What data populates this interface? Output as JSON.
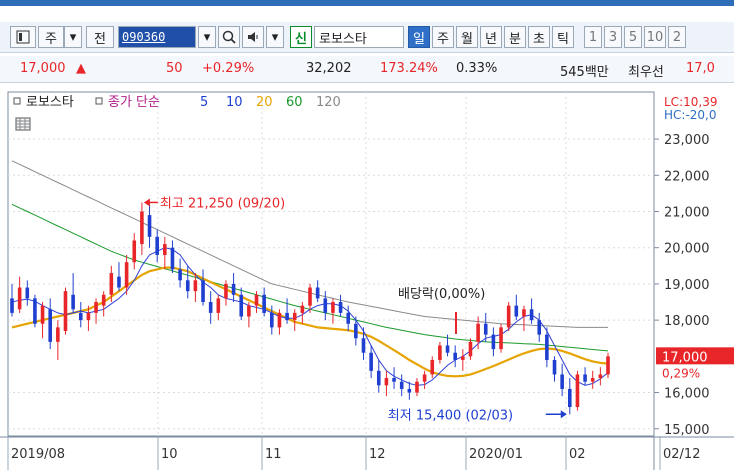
{
  "toolbar": {
    "icon": "window-icon",
    "type_label": "주",
    "prev_label": "전",
    "code": "090360",
    "search_icon": "search-icon",
    "speaker_icon": "speaker-icon",
    "credit_tag": "신",
    "stock_name": "로보스타",
    "periods": [
      "일",
      "주",
      "월",
      "년",
      "분",
      "초",
      "틱"
    ],
    "selected_period": "일",
    "numbers": [
      "1",
      "3",
      "5",
      "10",
      "2"
    ]
  },
  "quote": {
    "price": "17,000",
    "arrow": "▲",
    "change": "50",
    "change_pct": "+0.29%",
    "volume": "32,202",
    "volume_ratio": "173.24%",
    "turnover": "0.33%",
    "market_cap": "545백만",
    "preferred_label": "최우선",
    "preferred_value": "17,0"
  },
  "legend": {
    "stock_name": "로보스타",
    "ma_label": "종가 단순",
    "ma_periods": [
      "5",
      "10",
      "20",
      "60",
      "120"
    ],
    "ma_colors": [
      "#1f3fd0",
      "#1f3fd0",
      "#e6a400",
      "#1a9a2a",
      "#8a8a8a"
    ],
    "lc": "LC:10,39",
    "hc": "HC:-20,0"
  },
  "annotations": {
    "high": "최고 21,250 (09/20)",
    "low": "최저 15,400 (02/03)",
    "dividend": "배당락(0,00%)"
  },
  "current": {
    "price": "17,000",
    "pct": "0,29%"
  },
  "colors": {
    "up": "#e8262a",
    "down": "#1f3fd0",
    "accent": "#2f6fc7",
    "current_bg": "#e8262a"
  },
  "chart_data": {
    "type": "candlestick",
    "yticks": [
      "23,000",
      "22,000",
      "21,000",
      "20,000",
      "19,000",
      "18,000",
      "16,000",
      "15,000"
    ],
    "ytick_values": [
      23000,
      22000,
      21000,
      20000,
      19000,
      18000,
      16000,
      15000
    ],
    "ylim": [
      14800,
      24300
    ],
    "xticks": [
      "2019/08",
      "10",
      "11",
      "12",
      "2020/01",
      "02",
      "02/12"
    ],
    "grid": true,
    "ohlc": [
      [
        18600,
        19000,
        18100,
        18200
      ],
      [
        18300,
        19200,
        18200,
        18900
      ],
      [
        18900,
        19100,
        18400,
        18600
      ],
      [
        18600,
        18700,
        17800,
        17900
      ],
      [
        17900,
        18500,
        17500,
        18400
      ],
      [
        18300,
        18600,
        17200,
        17400
      ],
      [
        17400,
        18000,
        16900,
        17800
      ],
      [
        17700,
        18900,
        17600,
        18800
      ],
      [
        18700,
        19300,
        18200,
        18300
      ],
      [
        18200,
        18500,
        17800,
        18000
      ],
      [
        18000,
        18400,
        17700,
        18200
      ],
      [
        18200,
        18600,
        17900,
        18500
      ],
      [
        18400,
        18800,
        18100,
        18700
      ],
      [
        18700,
        19500,
        18500,
        19300
      ],
      [
        19200,
        19600,
        18800,
        18900
      ],
      [
        18900,
        19800,
        18700,
        19600
      ],
      [
        19600,
        20400,
        19400,
        20200
      ],
      [
        20100,
        21250,
        19800,
        21000
      ],
      [
        20900,
        21200,
        20000,
        20300
      ],
      [
        20300,
        20500,
        19600,
        19800
      ],
      [
        19800,
        20300,
        19400,
        20100
      ],
      [
        20000,
        20200,
        19300,
        19400
      ],
      [
        19400,
        19700,
        18900,
        19100
      ],
      [
        19100,
        19500,
        18600,
        18800
      ],
      [
        18800,
        19300,
        18500,
        19100
      ],
      [
        19100,
        19400,
        18400,
        18500
      ],
      [
        18500,
        18800,
        17900,
        18200
      ],
      [
        18200,
        18700,
        18000,
        18600
      ],
      [
        18600,
        19100,
        18400,
        19000
      ],
      [
        19000,
        19300,
        18500,
        18700
      ],
      [
        18700,
        18900,
        18000,
        18100
      ],
      [
        18100,
        18500,
        17800,
        18400
      ],
      [
        18400,
        18800,
        18200,
        18700
      ],
      [
        18700,
        18900,
        18100,
        18200
      ],
      [
        18200,
        18400,
        17600,
        17800
      ],
      [
        17800,
        18300,
        17600,
        18200
      ],
      [
        18200,
        18600,
        17900,
        18000
      ],
      [
        18000,
        18300,
        17700,
        18200
      ],
      [
        18200,
        18500,
        17900,
        18400
      ],
      [
        18400,
        19000,
        18200,
        18900
      ],
      [
        18900,
        19100,
        18500,
        18600
      ],
      [
        18600,
        18800,
        18000,
        18200
      ],
      [
        18200,
        18600,
        17900,
        18500
      ],
      [
        18500,
        18700,
        18100,
        18200
      ],
      [
        18200,
        18400,
        17700,
        17900
      ],
      [
        17900,
        18100,
        17300,
        17500
      ],
      [
        17500,
        17800,
        16900,
        17100
      ],
      [
        17100,
        17300,
        16400,
        16600
      ],
      [
        16600,
        16900,
        16000,
        16200
      ],
      [
        16200,
        16600,
        15900,
        16400
      ],
      [
        16400,
        16700,
        16100,
        16300
      ],
      [
        16300,
        16500,
        15900,
        16100
      ],
      [
        16100,
        16300,
        15800,
        16000
      ],
      [
        16000,
        16400,
        15900,
        16300
      ],
      [
        16300,
        16600,
        16100,
        16500
      ],
      [
        16500,
        17000,
        16400,
        16900
      ],
      [
        16900,
        17400,
        16800,
        17300
      ],
      [
        17300,
        17600,
        17000,
        17100
      ],
      [
        17100,
        17300,
        16700,
        16900
      ],
      [
        16900,
        17200,
        16600,
        17000
      ],
      [
        17000,
        17500,
        16900,
        17400
      ],
      [
        17400,
        18100,
        17200,
        17900
      ],
      [
        17900,
        18200,
        17400,
        17600
      ],
      [
        17600,
        17800,
        17000,
        17200
      ],
      [
        17200,
        17900,
        17100,
        17800
      ],
      [
        17800,
        18500,
        17700,
        18400
      ],
      [
        18400,
        18700,
        18000,
        18100
      ],
      [
        18100,
        18400,
        17700,
        18300
      ],
      [
        18300,
        18600,
        17900,
        18000
      ],
      [
        18000,
        18200,
        17400,
        17600
      ],
      [
        17600,
        17800,
        16700,
        16900
      ],
      [
        16900,
        17000,
        16300,
        16500
      ],
      [
        16500,
        16800,
        15900,
        16100
      ],
      [
        16100,
        16400,
        15400,
        15600
      ],
      [
        15600,
        16600,
        15500,
        16500
      ],
      [
        16500,
        16700,
        16200,
        16300
      ],
      [
        16300,
        16600,
        16100,
        16400
      ],
      [
        16400,
        16700,
        16200,
        16500
      ],
      [
        16500,
        17100,
        16400,
        17000
      ]
    ],
    "ma5": [
      18500,
      18550,
      18580,
      18520,
      18400,
      18300,
      18200,
      18150,
      18200,
      18250,
      18200,
      18250,
      18300,
      18450,
      18600,
      18800,
      19100,
      19500,
      19800,
      19900,
      20000,
      19950,
      19800,
      19500,
      19250,
      19050,
      18900,
      18700,
      18600,
      18550,
      18500,
      18400,
      18350,
      18300,
      18200,
      18100,
      18050,
      18050,
      18150,
      18300,
      18400,
      18450,
      18450,
      18400,
      18250,
      18000,
      17700,
      17300,
      16900,
      16600,
      16450,
      16350,
      16250,
      16200,
      16220,
      16350,
      16550,
      16750,
      16900,
      17000,
      17150,
      17350,
      17500,
      17550,
      17600,
      17750,
      17950,
      18100,
      18150,
      18000,
      17700,
      17300,
      16900,
      16500,
      16300,
      16200,
      16250,
      16380,
      16550
    ],
    "ma20": [
      17800,
      17850,
      17900,
      17950,
      18000,
      18050,
      18100,
      18150,
      18200,
      18250,
      18300,
      18400,
      18500,
      18650,
      18800,
      18950,
      19100,
      19250,
      19350,
      19400,
      19450,
      19450,
      19400,
      19350,
      19250,
      19150,
      19050,
      18950,
      18850,
      18750,
      18650,
      18550,
      18450,
      18350,
      18250,
      18150,
      18050,
      17950,
      17900,
      17850,
      17800,
      17780,
      17760,
      17740,
      17720,
      17680,
      17620,
      17540,
      17430,
      17300,
      17170,
      17040,
      16900,
      16780,
      16660,
      16560,
      16500,
      16460,
      16450,
      16460,
      16500,
      16570,
      16650,
      16730,
      16820,
      16910,
      17000,
      17080,
      17150,
      17200,
      17220,
      17200,
      17150,
      17080,
      17000,
      16920,
      16860,
      16820,
      16800
    ],
    "ma60": [
      21200,
      21100,
      21000,
      20900,
      20800,
      20700,
      20600,
      20500,
      20400,
      20300,
      20200,
      20100,
      20000,
      19900,
      19820,
      19740,
      19660,
      19600,
      19540,
      19480,
      19420,
      19360,
      19300,
      19240,
      19180,
      19120,
      19060,
      19000,
      18940,
      18880,
      18820,
      18760,
      18700,
      18640,
      18580,
      18520,
      18460,
      18400,
      18350,
      18300,
      18250,
      18200,
      18150,
      18100,
      18050,
      18000,
      17950,
      17900,
      17850,
      17800,
      17760,
      17720,
      17680,
      17640,
      17600,
      17570,
      17540,
      17510,
      17480,
      17460,
      17440,
      17420,
      17400,
      17390,
      17380,
      17370,
      17360,
      17350,
      17340,
      17330,
      17310,
      17290,
      17270,
      17250,
      17230,
      17210,
      17190,
      17170,
      17150
    ],
    "ma120": [
      22400,
      22300,
      22200,
      22100,
      22000,
      21900,
      21800,
      21700,
      21600,
      21500,
      21400,
      21300,
      21200,
      21100,
      21000,
      20900,
      20800,
      20700,
      20600,
      20500,
      20400,
      20300,
      20200,
      20100,
      20000,
      19900,
      19800,
      19700,
      19600,
      19500,
      19400,
      19300,
      19200,
      19100,
      19000,
      18950,
      18900,
      18850,
      18800,
      18750,
      18700,
      18650,
      18600,
      18550,
      18500,
      18460,
      18420,
      18380,
      18340,
      18300,
      18260,
      18220,
      18180,
      18140,
      18100,
      18080,
      18060,
      18040,
      18020,
      18000,
      17980,
      17960,
      17940,
      17920,
      17900,
      17890,
      17880,
      17870,
      17860,
      17850,
      17840,
      17830,
      17820,
      17810,
      17800,
      17800,
      17800,
      17800,
      17800
    ]
  }
}
